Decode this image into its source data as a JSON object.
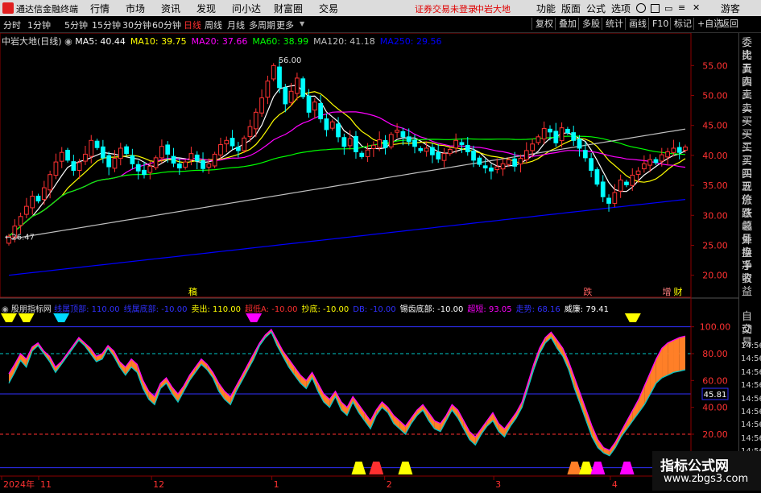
{
  "titlebar": {
    "app_name": "通达信金融终端",
    "menus": [
      "行情",
      "市场",
      "资讯",
      "发现",
      "问小达",
      "财富圈",
      "交易"
    ],
    "warning": "证券交易未登录",
    "stock": "中岩大地",
    "right_menus": [
      "功能",
      "版面",
      "公式",
      "选项"
    ],
    "guest": "游客"
  },
  "tabbar": {
    "periods": [
      "分时",
      "1分钟",
      "5分钟",
      "15分钟",
      "30分钟",
      "60分钟",
      "日线",
      "周线",
      "月线",
      "多周期",
      "更多"
    ],
    "active_period": "日线",
    "right_buttons": [
      "复权",
      "叠加",
      "多股",
      "统计",
      "画线",
      "F10",
      "标记",
      "+自选",
      "返回"
    ]
  },
  "right_panel": {
    "items": [
      "委比",
      "卖五",
      "卖四",
      "卖三",
      "卖二",
      "卖一",
      "买一",
      "买二",
      "买三",
      "买四",
      "买五",
      "现价",
      "涨跌",
      "涨幅",
      "总量",
      "外盘",
      "换手",
      "净资",
      "收益"
    ],
    "items2": [
      "自动",
      "交易"
    ],
    "times": [
      "14:56",
      "14:56",
      "14:56",
      "14:56",
      "14:56",
      "14:56",
      "14:56",
      "14:56",
      "14:56",
      "14:56"
    ]
  },
  "main_chart": {
    "header_name": "中岩大地(日线)",
    "ma_labels": [
      {
        "text": "MA5: 40.44",
        "color": "#ffffff"
      },
      {
        "text": "MA10: 39.75",
        "color": "#ffff00"
      },
      {
        "text": "MA20: 37.66",
        "color": "#ff00ff"
      },
      {
        "text": "MA60: 38.99",
        "color": "#00ff00"
      },
      {
        "text": "MA120: 41.18",
        "color": "#c0c0c0"
      },
      {
        "text": "MA250: 29.56",
        "color": "#0000ff"
      }
    ],
    "high_label": "56.00",
    "low_label": "26.47",
    "event_marks": [
      {
        "text": "稿",
        "color": "#ffff00",
        "at": "2023-12-12"
      },
      {
        "text": "跌",
        "color": "#ff6060",
        "at": "2024-03-26"
      },
      {
        "text": "增",
        "color": "#ff8080",
        "at": "2024-04-16"
      },
      {
        "text": "财",
        "color": "#ffff00",
        "at": "2024-04-19"
      }
    ]
  },
  "indicator": {
    "name": "股朋指标网",
    "items": [
      {
        "text": "线属顶部: 110.00",
        "color": "#3030ff"
      },
      {
        "text": "线属底部: -10.00",
        "color": "#3030ff"
      },
      {
        "text": "卖出: 110.00",
        "color": "#ffff00"
      },
      {
        "text": "超低A: -10.00",
        "color": "#ff3030"
      },
      {
        "text": "抄底: -10.00",
        "color": "#ffff00"
      },
      {
        "text": "DB: -10.00",
        "color": "#3030ff"
      },
      {
        "text": "锡齿底部: -10.00",
        "color": "#ffffff"
      },
      {
        "text": "超短: 93.05",
        "color": "#ff00ff"
      },
      {
        "text": "走势: 68.16",
        "color": "#3030ff"
      },
      {
        "text": "威廉: 79.41",
        "color": "#ffffff"
      }
    ],
    "current_value": "45.81"
  },
  "x_axis": {
    "labels": [
      {
        "text": "2024年",
        "date": "2023-10-23"
      },
      {
        "text": "11",
        "date": "2023-11-01"
      },
      {
        "text": "12",
        "date": "2023-12-01"
      },
      {
        "text": "1",
        "date": "2024-01-02"
      },
      {
        "text": "2",
        "date": "2024-02-01"
      },
      {
        "text": "3",
        "date": "2024-03-01"
      },
      {
        "text": "4",
        "date": "2024-04-01"
      }
    ]
  },
  "watermark": {
    "title": "指标公式网",
    "url": "www.zbgs3.com"
  },
  "colors": {
    "up": "#ff3232",
    "down": "#00ffff",
    "grid": "#8b0000",
    "orange": "#ff7f27",
    "purple": "#ff00ff",
    "yellow": "#ffff00",
    "blue": "#3030ff"
  },
  "chart_data": [
    {
      "type": "candlestick",
      "title": "中岩大地(日线)",
      "ylim": [
        17,
        58
      ],
      "y_ticks": [
        20.0,
        25.0,
        30.0,
        35.0,
        40.0,
        45.0,
        50.0,
        55.0
      ],
      "x_start": "2023-10-23",
      "x_end": "2024-04-22",
      "closes": [
        26.5,
        28.2,
        29.8,
        31.5,
        33.2,
        32.4,
        34.6,
        36.8,
        38.9,
        40.5,
        39.2,
        37.5,
        38.8,
        40.2,
        42.5,
        41.3,
        39.6,
        38.1,
        39.5,
        41.2,
        40.3,
        38.6,
        37.4,
        36.8,
        38.2,
        39.6,
        41.5,
        40.2,
        38.7,
        37.9,
        38.9,
        40.3,
        39.1,
        37.8,
        38.6,
        40.2,
        41.8,
        42.5,
        41.6,
        40.8,
        42.9,
        44.8,
        47.2,
        49.6,
        52.4,
        55.0,
        51.3,
        48.6,
        50.7,
        52.9,
        49.8,
        47.2,
        48.9,
        46.1,
        44.3,
        45.6,
        43.1,
        41.5,
        42.8,
        40.6,
        39.8,
        40.9,
        41.7,
        42.6,
        41.3,
        43.5,
        44.2,
        43.1,
        42.3,
        41.5,
        40.8,
        41.2,
        40.1,
        39.4,
        40.3,
        41.0,
        42.5,
        41.8,
        40.6,
        39.2,
        38.5,
        37.9,
        37.4,
        38.1,
        38.6,
        39.3,
        38.2,
        39.5,
        40.8,
        41.9,
        43.1,
        44.5,
        43.9,
        42.1,
        44.6,
        43.8,
        42.5,
        41.2,
        39.6,
        37.5,
        35.2,
        33.1,
        32.0,
        33.8,
        35.9,
        35.1,
        36.7,
        37.4,
        38.6,
        39.3,
        38.8,
        40.1,
        40.6,
        41.2,
        40.5,
        41.4
      ],
      "series": [
        {
          "name": "MA5",
          "color": "#ffffff"
        },
        {
          "name": "MA10",
          "color": "#ffff00"
        },
        {
          "name": "MA20",
          "color": "#ff00ff"
        },
        {
          "name": "MA60",
          "color": "#00ff00"
        },
        {
          "name": "MA120",
          "color": "#c0c0c0"
        },
        {
          "name": "MA250",
          "color": "#0000ff"
        }
      ]
    },
    {
      "type": "line",
      "title": "股朋指标网",
      "ylim": [
        -10,
        110
      ],
      "y_ticks": [
        20.0,
        40.0,
        60.0,
        80.0,
        100.0
      ],
      "x_start": "2023-10-23",
      "x_end": "2024-04-22",
      "series": [
        {
          "name": "超短",
          "color": "#ff00ff",
          "values": [
            65,
            72,
            80,
            76,
            85,
            88,
            82,
            78,
            70,
            74,
            80,
            86,
            92,
            88,
            84,
            78,
            80,
            86,
            82,
            74,
            70,
            76,
            72,
            60,
            52,
            48,
            58,
            62,
            55,
            50,
            56,
            64,
            70,
            76,
            72,
            66,
            58,
            52,
            48,
            56,
            64,
            72,
            80,
            88,
            94,
            98,
            90,
            82,
            76,
            70,
            64,
            60,
            66,
            58,
            50,
            46,
            52,
            44,
            40,
            48,
            42,
            36,
            30,
            38,
            44,
            40,
            34,
            30,
            26,
            32,
            38,
            42,
            36,
            30,
            28,
            34,
            42,
            38,
            30,
            22,
            18,
            24,
            30,
            36,
            28,
            24,
            30,
            36,
            44,
            58,
            72,
            84,
            92,
            96,
            90,
            84,
            74,
            62,
            50,
            38,
            26,
            16,
            10,
            8,
            14,
            22,
            30,
            38,
            46,
            56,
            66,
            76,
            84,
            88,
            90,
            92,
            93
          ]
        },
        {
          "name": "走势",
          "color": "#00c8c8",
          "values": [
            58,
            66,
            75,
            70,
            82,
            86,
            80,
            74,
            66,
            72,
            78,
            84,
            90,
            86,
            80,
            74,
            76,
            84,
            78,
            70,
            64,
            70,
            66,
            54,
            46,
            42,
            54,
            58,
            50,
            44,
            52,
            60,
            66,
            72,
            68,
            62,
            52,
            46,
            42,
            52,
            60,
            68,
            76,
            86,
            92,
            96,
            86,
            78,
            70,
            64,
            58,
            54,
            62,
            52,
            44,
            40,
            48,
            38,
            34,
            44,
            36,
            30,
            24,
            34,
            40,
            36,
            28,
            24,
            20,
            28,
            34,
            38,
            30,
            24,
            22,
            30,
            38,
            32,
            24,
            16,
            12,
            20,
            26,
            30,
            22,
            18,
            26,
            32,
            40,
            54,
            68,
            80,
            88,
            92,
            84,
            78,
            68,
            54,
            42,
            30,
            18,
            10,
            6,
            4,
            10,
            18,
            24,
            30,
            36,
            42,
            50,
            58,
            62,
            64,
            66,
            67,
            68
          ]
        }
      ],
      "hlines": [
        {
          "value": 100,
          "color": "#3030ff"
        },
        {
          "value": 80,
          "color": "#00c8c8"
        },
        {
          "value": 50,
          "color": "#3030ff"
        },
        {
          "value": 20,
          "color": "#ff3030"
        },
        {
          "value": -5,
          "color": "#3030ff"
        }
      ]
    }
  ]
}
